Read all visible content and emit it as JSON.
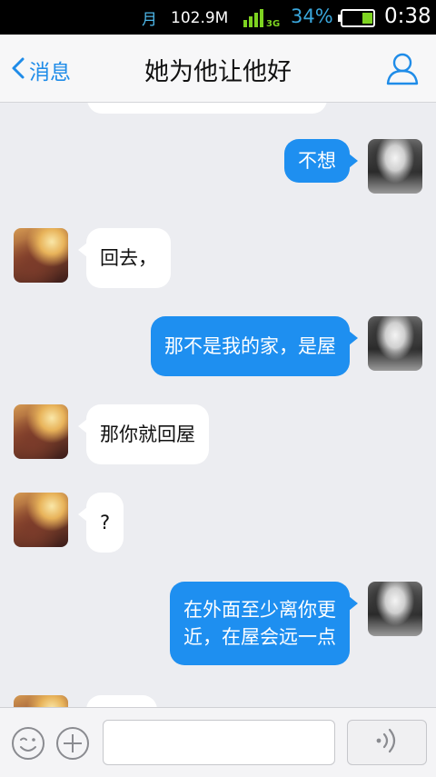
{
  "status_bar": {
    "moon_glyph": "月",
    "network_speed": "102.9M",
    "network_type": "3G",
    "battery_percent": "34%",
    "battery_level": 0.34,
    "time": "0:38"
  },
  "nav": {
    "back_label": "消息",
    "title": "她为他让他好",
    "back_icon": "chevron-left-icon",
    "profile_icon": "person-icon"
  },
  "messages": [
    {
      "side": "out",
      "text": "不想"
    },
    {
      "side": "in",
      "text": "回去，"
    },
    {
      "side": "out",
      "text": "那不是我的家，是屋"
    },
    {
      "side": "in",
      "text": "那你就回屋"
    },
    {
      "side": "in",
      "text": "?"
    },
    {
      "side": "out",
      "text": "在外面至少离你更\n近，在屋会远一点"
    }
  ],
  "input_bar": {
    "emoji_icon": "smiley-icon",
    "plus_icon": "plus-circle-icon",
    "voice_icon": "voice-wave-icon",
    "text_value": ""
  },
  "colors": {
    "accent": "#1e8ff0",
    "background": "#ecedf1",
    "incoming_bubble": "#ffffff"
  }
}
